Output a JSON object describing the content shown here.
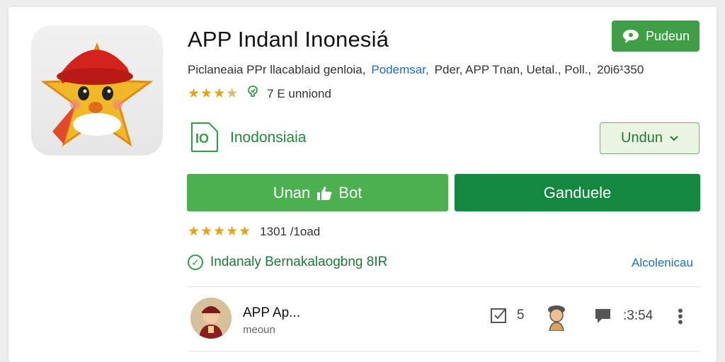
{
  "app": {
    "title": "APP Indanl Inonesiá",
    "top_button_label": "Pudeun",
    "meta": [
      {
        "text": "Piclaneaia PPr llacablaid genloia,",
        "link": false
      },
      {
        "text": "Podemsar,",
        "link": true
      },
      {
        "text": "Pder, APP Tnan, Uetal., Poll.,",
        "link": false
      },
      {
        "text": "20i6¹350",
        "link": false
      }
    ],
    "rating_stars": 3.5,
    "rating_text": "7 E unniond",
    "language_label": "Inodonsiaia",
    "language_select_label": "Undun",
    "install_button_label": "Unan",
    "install_button_label_2": "Bot",
    "secondary_button_label": "Ganduele",
    "review_stars": 5,
    "review_text": "1301 /1oad",
    "verified_text": "Indanaly Bernakalaogbng 8IR",
    "more_link": "Alcolenicau",
    "developer": {
      "name": "APP Ap...",
      "subtitle": "meoun"
    },
    "stats": {
      "checks": "5",
      "comments": ":3:54"
    }
  },
  "colors": {
    "primary_green": "#4caf50",
    "dark_green": "#14883f",
    "link_blue": "#1a6fc2",
    "star": "#e8a316"
  },
  "icons": [
    "star-mascot-icon",
    "message-bubble-icon",
    "language-icon",
    "chevron-down-icon",
    "thumbs-up-icon",
    "check-circle-icon",
    "checkbox-icon",
    "person-icon",
    "comment-icon",
    "more-vert-icon"
  ]
}
